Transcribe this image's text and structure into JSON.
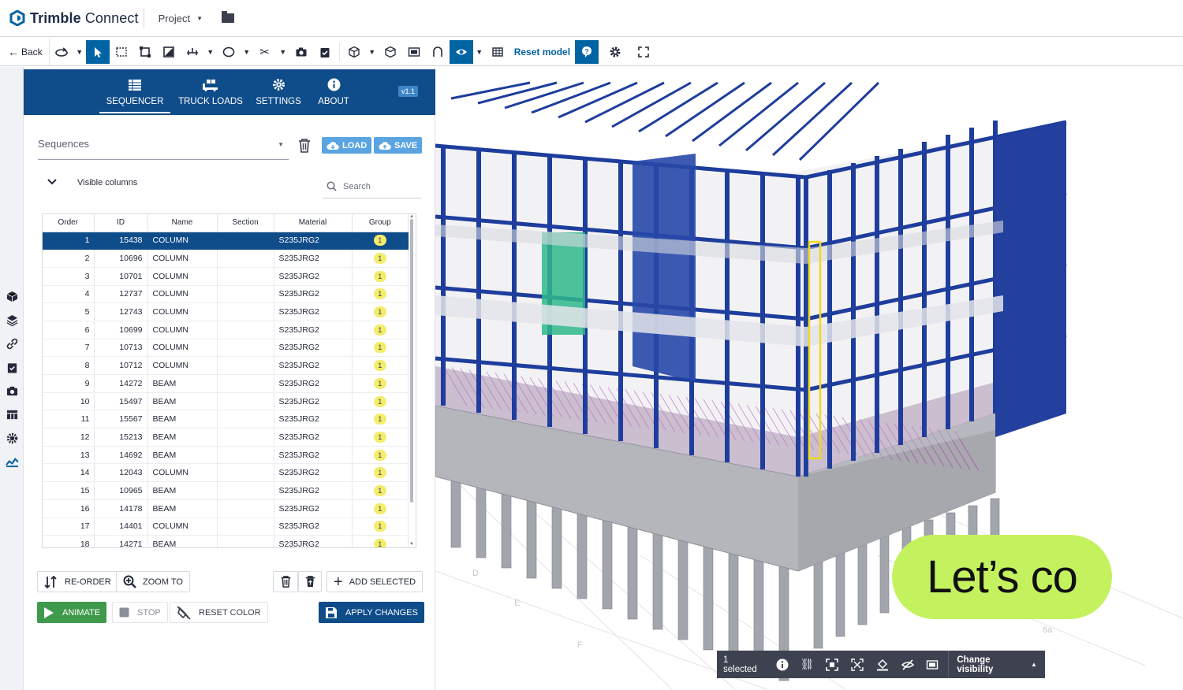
{
  "app": {
    "brand_bold": "Trimble",
    "brand_light": " Connect",
    "project_label": "Project"
  },
  "toolbar": {
    "back_label": "Back",
    "reset_model_label": "Reset model"
  },
  "extension": {
    "tabs": [
      {
        "label": "SEQUENCER",
        "icon": "table-icon",
        "active": true
      },
      {
        "label": "TRUCK LOADS",
        "icon": "truck-icon",
        "active": false
      },
      {
        "label": "SETTINGS",
        "icon": "gear-icon",
        "active": false
      },
      {
        "label": "ABOUT",
        "icon": "info-icon",
        "active": false
      }
    ],
    "version": "v1.1"
  },
  "sequencer": {
    "sequences_placeholder": "Sequences",
    "load_label": "LOAD",
    "save_label": "SAVE",
    "visible_columns_label": "Visible columns",
    "search_placeholder": "Search",
    "columns": [
      "Order",
      "ID",
      "Name",
      "Section",
      "Material",
      "Group"
    ],
    "rows": [
      {
        "order": "1",
        "id": "15438",
        "name": "COLUMN",
        "section": "",
        "material": "S235JRG2",
        "group": "1",
        "selected": true
      },
      {
        "order": "2",
        "id": "10696",
        "name": "COLUMN",
        "section": "",
        "material": "S235JRG2",
        "group": "1"
      },
      {
        "order": "3",
        "id": "10701",
        "name": "COLUMN",
        "section": "",
        "material": "S235JRG2",
        "group": "1"
      },
      {
        "order": "4",
        "id": "12737",
        "name": "COLUMN",
        "section": "",
        "material": "S235JRG2",
        "group": "1"
      },
      {
        "order": "5",
        "id": "12743",
        "name": "COLUMN",
        "section": "",
        "material": "S235JRG2",
        "group": "1"
      },
      {
        "order": "6",
        "id": "10699",
        "name": "COLUMN",
        "section": "",
        "material": "S235JRG2",
        "group": "1"
      },
      {
        "order": "7",
        "id": "10713",
        "name": "COLUMN",
        "section": "",
        "material": "S235JRG2",
        "group": "1"
      },
      {
        "order": "8",
        "id": "10712",
        "name": "COLUMN",
        "section": "",
        "material": "S235JRG2",
        "group": "1"
      },
      {
        "order": "9",
        "id": "14272",
        "name": "BEAM",
        "section": "",
        "material": "S235JRG2",
        "group": "1"
      },
      {
        "order": "10",
        "id": "15497",
        "name": "BEAM",
        "section": "",
        "material": "S235JRG2",
        "group": "1"
      },
      {
        "order": "11",
        "id": "15567",
        "name": "BEAM",
        "section": "",
        "material": "S235JRG2",
        "group": "1"
      },
      {
        "order": "12",
        "id": "15213",
        "name": "BEAM",
        "section": "",
        "material": "S235JRG2",
        "group": "1"
      },
      {
        "order": "13",
        "id": "14692",
        "name": "BEAM",
        "section": "",
        "material": "S235JRG2",
        "group": "1"
      },
      {
        "order": "14",
        "id": "12043",
        "name": "COLUMN",
        "section": "",
        "material": "S235JRG2",
        "group": "1"
      },
      {
        "order": "15",
        "id": "10965",
        "name": "BEAM",
        "section": "",
        "material": "S235JRG2",
        "group": "1"
      },
      {
        "order": "16",
        "id": "14178",
        "name": "BEAM",
        "section": "",
        "material": "S235JRG2",
        "group": "1"
      },
      {
        "order": "17",
        "id": "14401",
        "name": "COLUMN",
        "section": "",
        "material": "S235JRG2",
        "group": "1"
      },
      {
        "order": "18",
        "id": "14271",
        "name": "BEAM",
        "section": "",
        "material": "S235JRG2",
        "group": "1"
      }
    ],
    "reorder_label": "RE-ORDER",
    "zoom_to_label": "ZOOM TO",
    "add_selected_label": "ADD SELECTED",
    "animate_label": "ANIMATE",
    "stop_label": "STOP",
    "reset_color_label": "RESET COLOR",
    "apply_changes_label": "APPLY CHANGES"
  },
  "viewport": {
    "selected_count": "1 selected",
    "change_visibility_label": "Change visibility",
    "grid_labels": [
      "D",
      "E",
      "F",
      "2",
      "6a"
    ],
    "overlay_text": "Let’s co"
  },
  "colors": {
    "brand_blue": "#0f4c8a",
    "accent_blue": "#0063a3",
    "steel_blue": "#1e3d9c",
    "concrete": "#9c9ea6",
    "highlight_yellow": "#f3ec6d",
    "animate_green": "#3f9a4c",
    "lime": "#c4f25f"
  }
}
